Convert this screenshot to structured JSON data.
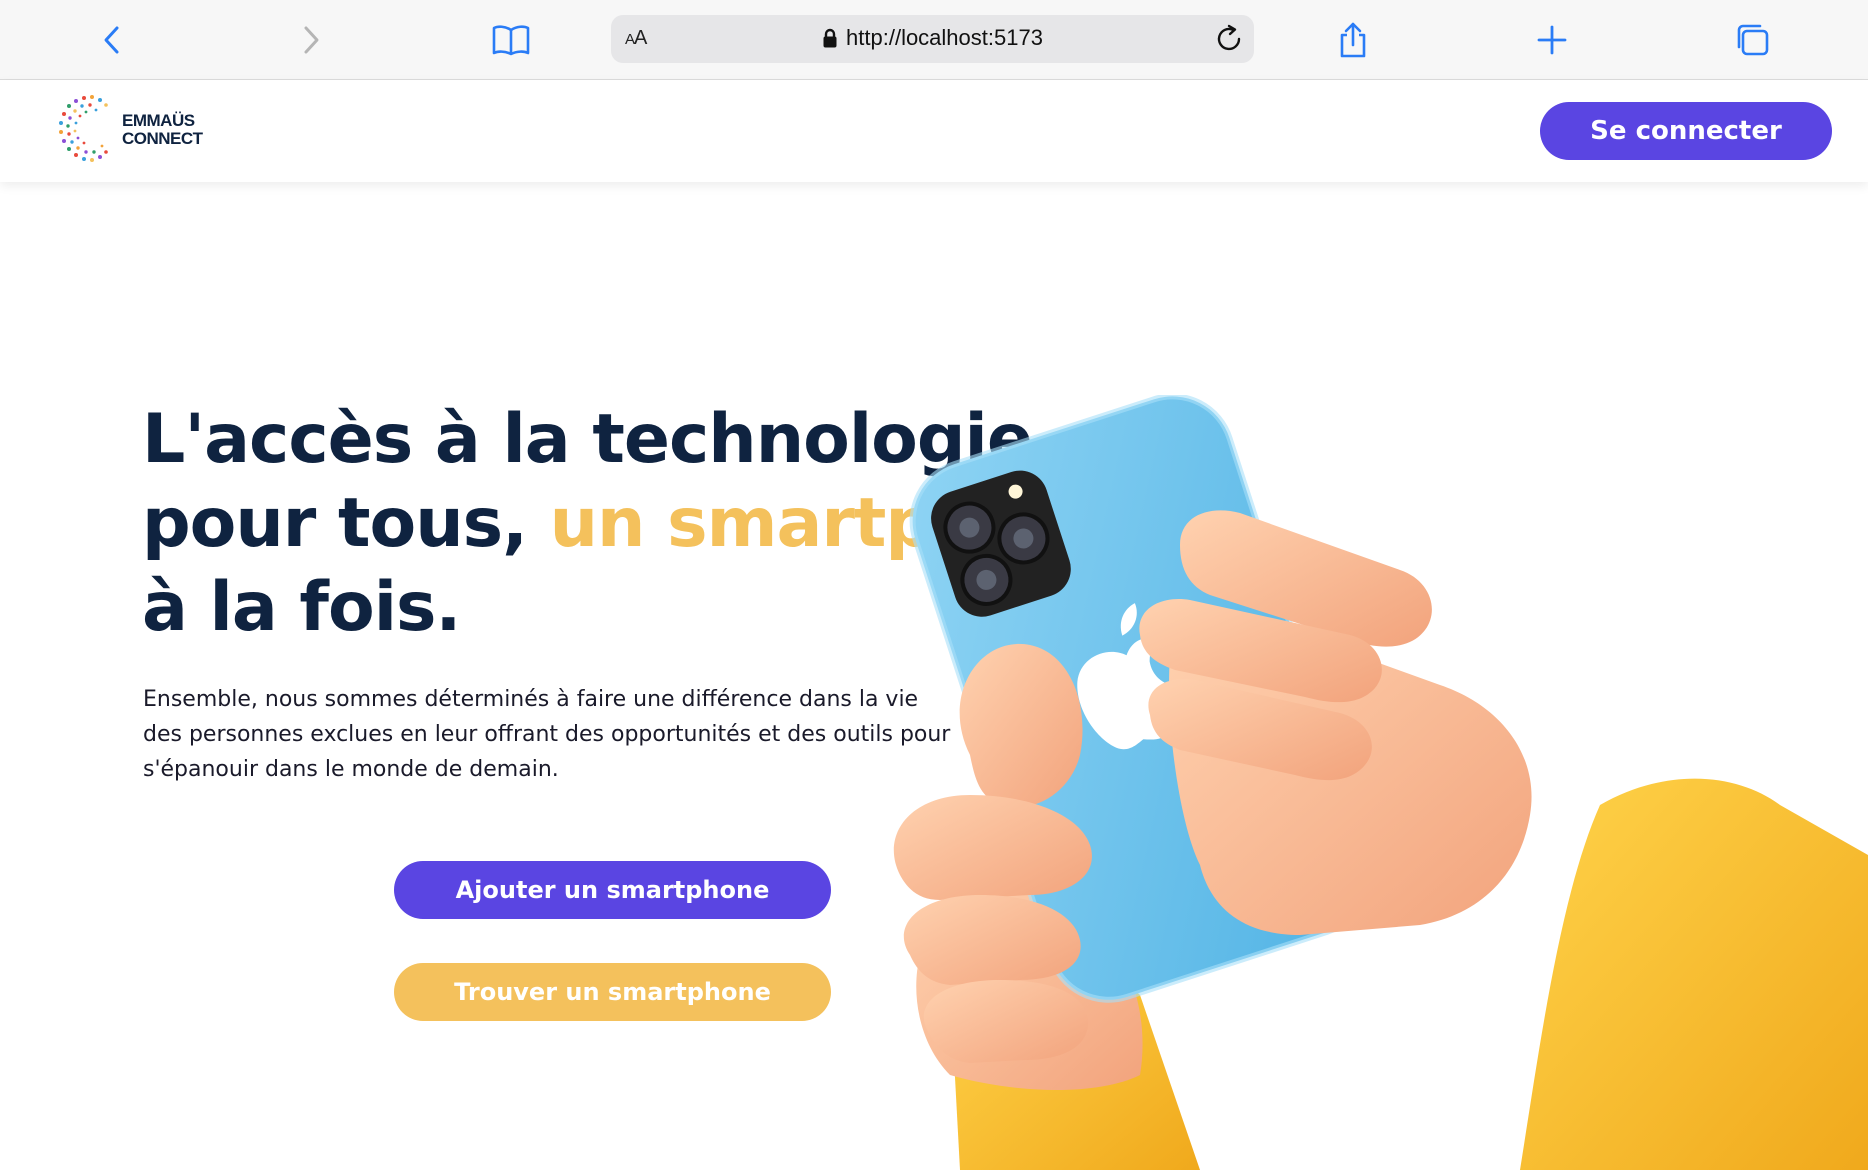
{
  "browser": {
    "url": "http://localhost:5173",
    "reader_label": "AA"
  },
  "header": {
    "logo_line1": "EMMAÜS",
    "logo_line2": "CONNECT",
    "login_label": "Se connecter"
  },
  "hero": {
    "title_part1": "L'accès à la technologie",
    "title_part2": "pour tous, ",
    "title_accent": "un smartphone",
    "title_part3": "à la fois.",
    "description": "Ensemble, nous sommes déterminés à faire une différence dans la vie des personnes exclues en leur offrant des opportunités et des outils pour s'épanouir dans le monde de demain.",
    "primary_cta": "Ajouter un smartphone",
    "secondary_cta": "Trouver un smartphone"
  },
  "colors": {
    "brand_purple": "#5a45e2",
    "accent_yellow": "#f4c15c",
    "title_navy": "#0f2340",
    "phone_blue": "#74c7ec"
  }
}
